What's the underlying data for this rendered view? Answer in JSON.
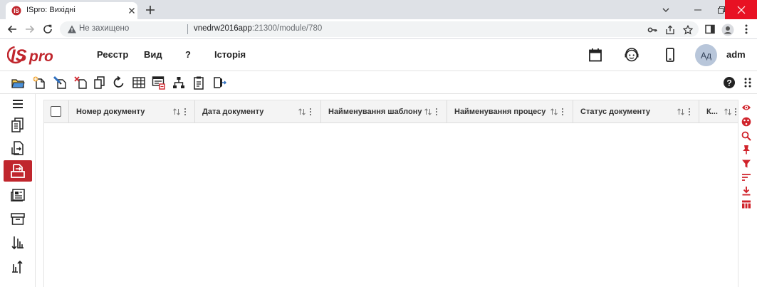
{
  "browser": {
    "tab_title": "ISpro: Вихідні",
    "insecure_label": "Не захищено",
    "url_host": "vnedrw2016app",
    "url_path": ":21300/module/780"
  },
  "app": {
    "logo_text": "ISpro",
    "menu": [
      "Реєстр",
      "Вид",
      "?",
      "Історія"
    ],
    "avatar_initials": "Ад",
    "username": "adm"
  },
  "grid": {
    "columns": [
      {
        "label": "Номер документу"
      },
      {
        "label": "Дата документу"
      },
      {
        "label": "Найменування шаблону"
      },
      {
        "label": "Найменування процесу"
      },
      {
        "label": "Статус документу"
      },
      {
        "label": "К..."
      }
    ],
    "rows": []
  },
  "colors": {
    "brand": "#c0262d",
    "accent_red": "#d0232b"
  },
  "icons": {
    "toolbar": [
      "open-folder-icon",
      "new-document-icon",
      "edit-document-icon",
      "delete-document-icon",
      "copy-icon",
      "refresh-icon",
      "table-grid-icon",
      "calendar-report-icon",
      "hierarchy-icon",
      "clipboard-icon",
      "export-icon"
    ],
    "sidebar": [
      "list-menu-icon",
      "documents-icon",
      "document-arrow-icon",
      "outgoing-icon",
      "news-icon",
      "archive-icon",
      "sort-down-icon",
      "sort-up-icon"
    ],
    "right_bar": [
      "eye-icon",
      "palette-icon",
      "search-icon",
      "pin-icon",
      "filter-icon",
      "sort-lines-icon",
      "download-icon",
      "columns-icon"
    ]
  }
}
